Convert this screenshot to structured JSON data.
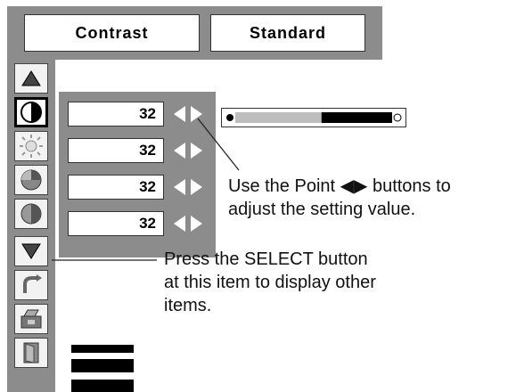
{
  "header": {
    "parameter": "Contrast",
    "mode": "Standard"
  },
  "adjust_rows": [
    {
      "value": "32"
    },
    {
      "value": "32"
    },
    {
      "value": "32"
    },
    {
      "value": "32"
    }
  ],
  "level_bar": {
    "fraction": 0.55
  },
  "sidebar_icons": [
    "scroll-up-icon",
    "contrast-icon",
    "brightness-icon",
    "color-icon",
    "tint-icon",
    "scroll-down-icon",
    "reset-icon",
    "store-icon",
    "quit-icon"
  ],
  "callouts": {
    "point": {
      "line1": "Use the Point ◀▶ buttons to",
      "line2": "adjust the setting value."
    },
    "select": {
      "line1": "Press the SELECT button",
      "line2": "at this item to display other",
      "line3": "items."
    }
  },
  "colors": {
    "menu_gray": "#8c8c8c",
    "selected_border": "#000000"
  }
}
